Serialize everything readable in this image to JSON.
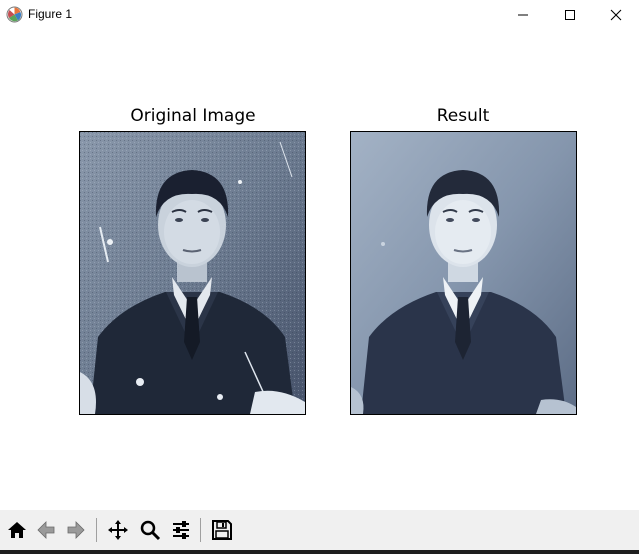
{
  "window": {
    "title": "Figure 1",
    "icons": [
      "matplotlib-app-icon",
      "minimize-icon",
      "maximize-icon",
      "close-icon"
    ]
  },
  "figure": {
    "panels": [
      {
        "title": "Original Image",
        "content": "scanned vintage portrait photo with scratches"
      },
      {
        "title": "Result",
        "content": "restored vintage portrait photo"
      }
    ]
  },
  "toolbar": {
    "buttons": [
      "home-icon",
      "back-icon",
      "forward-icon",
      "pan-icon",
      "zoom-icon",
      "configure-subplots-icon",
      "save-icon"
    ]
  }
}
